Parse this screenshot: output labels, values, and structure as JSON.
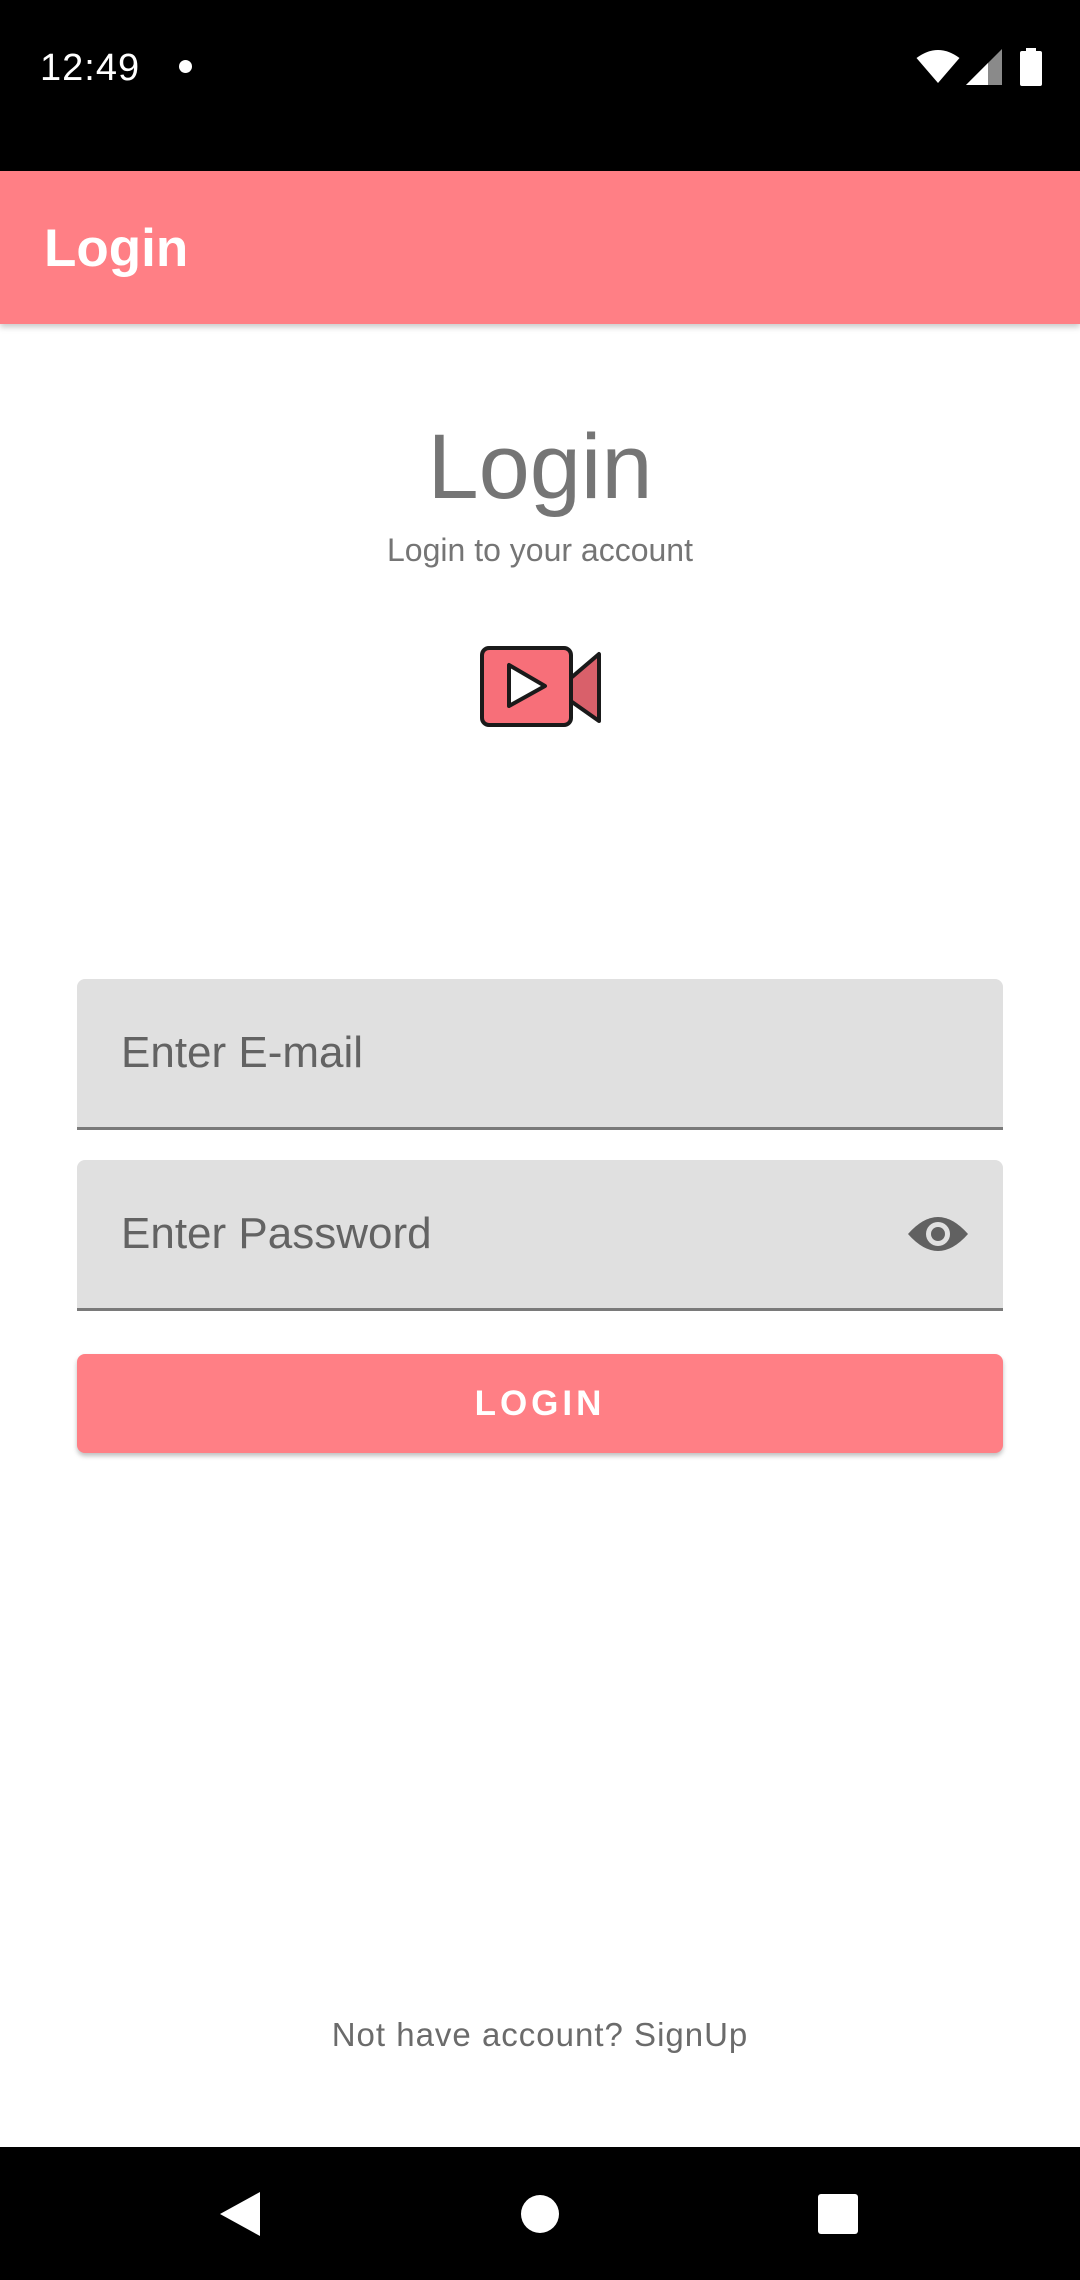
{
  "status_bar": {
    "time": "12:49",
    "icons": [
      "notification-dot-icon",
      "wifi-icon",
      "signal-icon",
      "battery-icon"
    ]
  },
  "app_bar": {
    "title": "Login"
  },
  "header": {
    "title": "Login",
    "subtitle": "Login to your account",
    "logo_icon": "video-camera-play-icon"
  },
  "form": {
    "email": {
      "placeholder": "Enter E-mail",
      "value": ""
    },
    "password": {
      "placeholder": "Enter Password",
      "value": "",
      "toggle_icon": "eye-icon"
    },
    "login_label": "LOGIN"
  },
  "footer": {
    "signup_text": "Not have account? SignUp"
  },
  "nav_bar": {
    "icons": [
      "back-icon",
      "home-icon",
      "recents-icon"
    ]
  },
  "colors": {
    "accent": "#ff7f85",
    "text_gray": "#757575",
    "field_bg": "#e0e0e0",
    "system_bars": "#000000"
  }
}
